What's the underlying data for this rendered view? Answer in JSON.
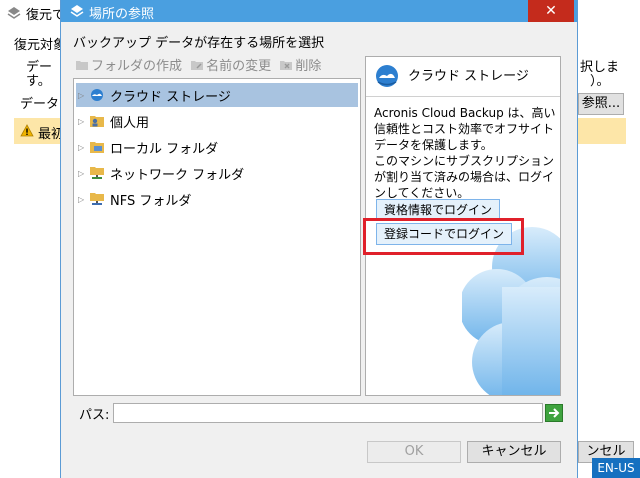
{
  "background_window": {
    "title": "復元で",
    "line1": "復元対象",
    "line2a": "デー",
    "line2b": "す。",
    "line3": "データ",
    "right_text1": "択しま",
    "right_text2": "）。",
    "warning_text": "最初",
    "browse_button": "参照...",
    "cancel_fragment": "ンセル"
  },
  "dialog": {
    "title": "場所の参照",
    "close_glyph": "✕",
    "instruction": "バックアップ データが存在する場所を選択",
    "toolbar": {
      "create_folder": "フォルダの作成",
      "rename": "名前の変更",
      "delete": "削除"
    },
    "tree": [
      {
        "label": "クラウド ストレージ",
        "icon": "cloud-storage-icon",
        "selected": true
      },
      {
        "label": "個人用",
        "icon": "personal-folder-icon",
        "selected": false
      },
      {
        "label": "ローカル フォルダ",
        "icon": "local-folder-icon",
        "selected": false
      },
      {
        "label": "ネットワーク フォルダ",
        "icon": "network-folder-icon",
        "selected": false
      },
      {
        "label": "NFS フォルダ",
        "icon": "nfs-folder-icon",
        "selected": false
      }
    ],
    "info": {
      "header": "クラウド ストレージ",
      "body1": "Acronis Cloud Backup は、高い信頼性とコスト効率でオフサイトデータを保護します。",
      "body2": "このマシンにサブスクリプションが割り当て済みの場合は、ログインしてください。",
      "login_credentials": "資格情報でログイン",
      "login_regcode": "登録コードでログイン"
    },
    "path_label": "パス:",
    "path_value": "",
    "ok_button": "OK",
    "cancel_button": "キャンセル"
  },
  "language_badge": "EN-US",
  "colors": {
    "titlebar": "#4a9fe0",
    "highlight": "#e0202a",
    "selection": "#a8c3e0"
  }
}
